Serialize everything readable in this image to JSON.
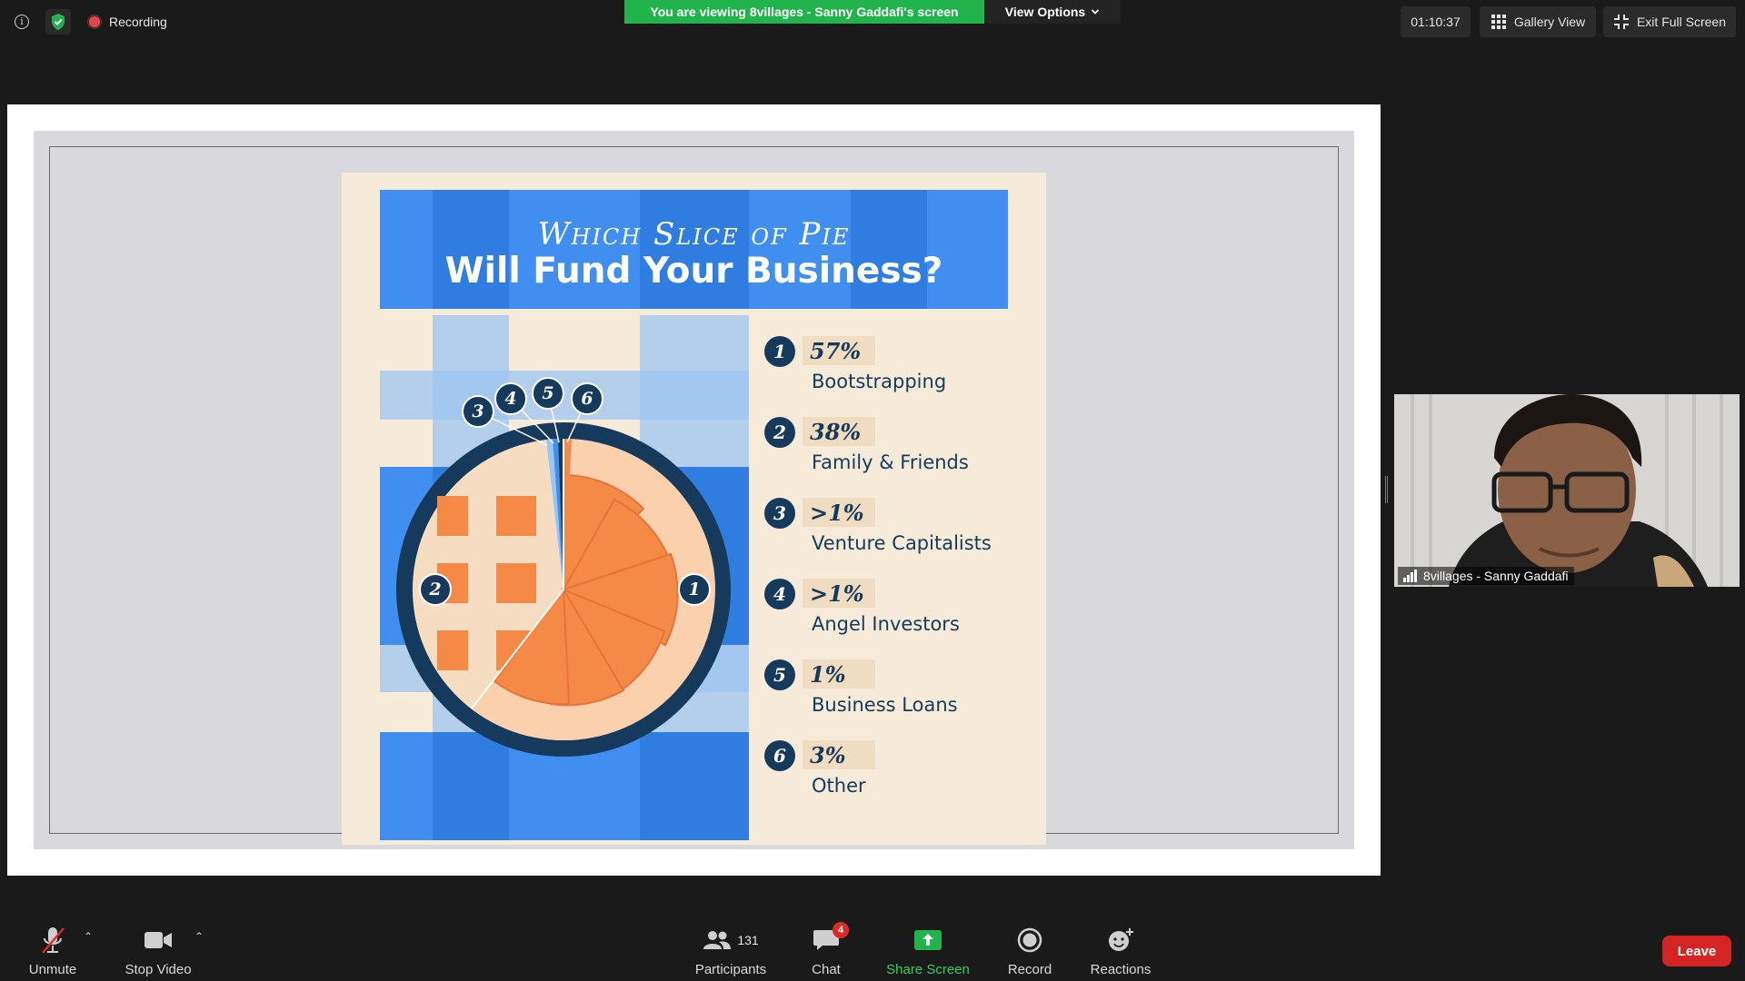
{
  "topbar": {
    "recording_label": "Recording",
    "viewing_banner": "You are viewing 8villages - Sanny Gaddafi's screen",
    "view_options_label": "View Options",
    "timer": "01:10:37",
    "gallery_view_label": "Gallery View",
    "exit_fullscreen_label": "Exit Full Screen"
  },
  "slide": {
    "title_line1": "Which Slice of Pie",
    "title_line2": "Will Fund Your Business?",
    "items": [
      {
        "num": "1",
        "pct": "57%",
        "label": "Bootstrapping"
      },
      {
        "num": "2",
        "pct": "38%",
        "label": "Family & Friends"
      },
      {
        "num": "3",
        "pct": ">1%",
        "label": "Venture Capitalists"
      },
      {
        "num": "4",
        "pct": ">1%",
        "label": "Angel Investors"
      },
      {
        "num": "5",
        "pct": "1%",
        "label": "Business Loans"
      },
      {
        "num": "6",
        "pct": "3%",
        "label": "Other"
      }
    ],
    "colors": {
      "blue": "#3f8ef0",
      "light_blue": "#9cc6f2",
      "navy": "#163a5c",
      "orange": "#f48a45",
      "cream": "#f6ead8"
    }
  },
  "video": {
    "participant_name": "8villages - Sanny Gaddafi"
  },
  "toolbar": {
    "unmute_label": "Unmute",
    "stop_video_label": "Stop Video",
    "participants_label": "Participants",
    "participants_count": "131",
    "chat_label": "Chat",
    "chat_badge": "4",
    "share_screen_label": "Share Screen",
    "record_label": "Record",
    "reactions_label": "Reactions",
    "leave_label": "Leave"
  }
}
